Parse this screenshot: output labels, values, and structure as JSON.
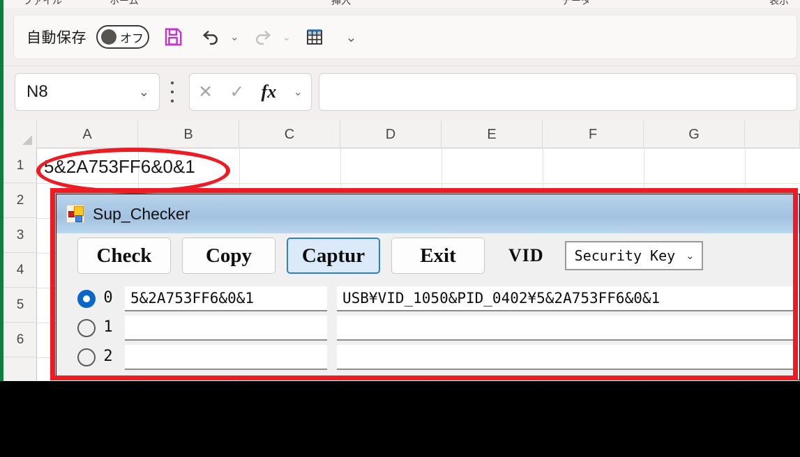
{
  "app": {
    "ribbon_tabs": [
      "ファイル",
      "ホーム",
      "挿入",
      "データ",
      "表示"
    ],
    "autosave": {
      "label": "自動保存",
      "state": "オフ"
    },
    "quick_access": [
      {
        "name": "save-icon",
        "glyph": "save"
      },
      {
        "name": "undo-icon",
        "glyph": "undo"
      },
      {
        "name": "redo-icon",
        "glyph": "redo"
      },
      {
        "name": "table-icon",
        "glyph": "table"
      },
      {
        "name": "qat-more-icon",
        "glyph": "chevron-down"
      }
    ],
    "name_box": {
      "value": "N8",
      "placeholder": "N8"
    },
    "formula_bar": {
      "value": "",
      "cancel_icon": "✕",
      "enter_icon": "✓",
      "fx_icon": "fx",
      "expand_icon": "⌄"
    }
  },
  "sheet": {
    "columns": [
      "A",
      "B",
      "C",
      "D",
      "E",
      "F",
      "G"
    ],
    "rows": [
      "1",
      "2",
      "3",
      "4",
      "5",
      "6"
    ],
    "cells": {
      "A1": "5&2A753FF6&0&1"
    }
  },
  "annotations": {
    "ellipse_color": "#ed1c24",
    "rect_color": "#ed1c24"
  },
  "dialog": {
    "title": "Sup_Checker",
    "icon": "windows-forms-icon",
    "buttons": [
      {
        "label": "Check",
        "focused": false
      },
      {
        "label": "Copy",
        "focused": false
      },
      {
        "label": "Captur",
        "focused": true
      },
      {
        "label": "Exit",
        "focused": false
      }
    ],
    "vid": {
      "label": "VID",
      "selected": "Security Key",
      "caret": "⌄"
    },
    "rows": [
      {
        "index": "0",
        "selected": true,
        "serial": "5&2A753FF6&0&1",
        "path": "USB¥VID_1050&PID_0402¥5&2A753FF6&0&1"
      },
      {
        "index": "1",
        "selected": false,
        "serial": "",
        "path": ""
      },
      {
        "index": "2",
        "selected": false,
        "serial": "",
        "path": ""
      }
    ]
  }
}
